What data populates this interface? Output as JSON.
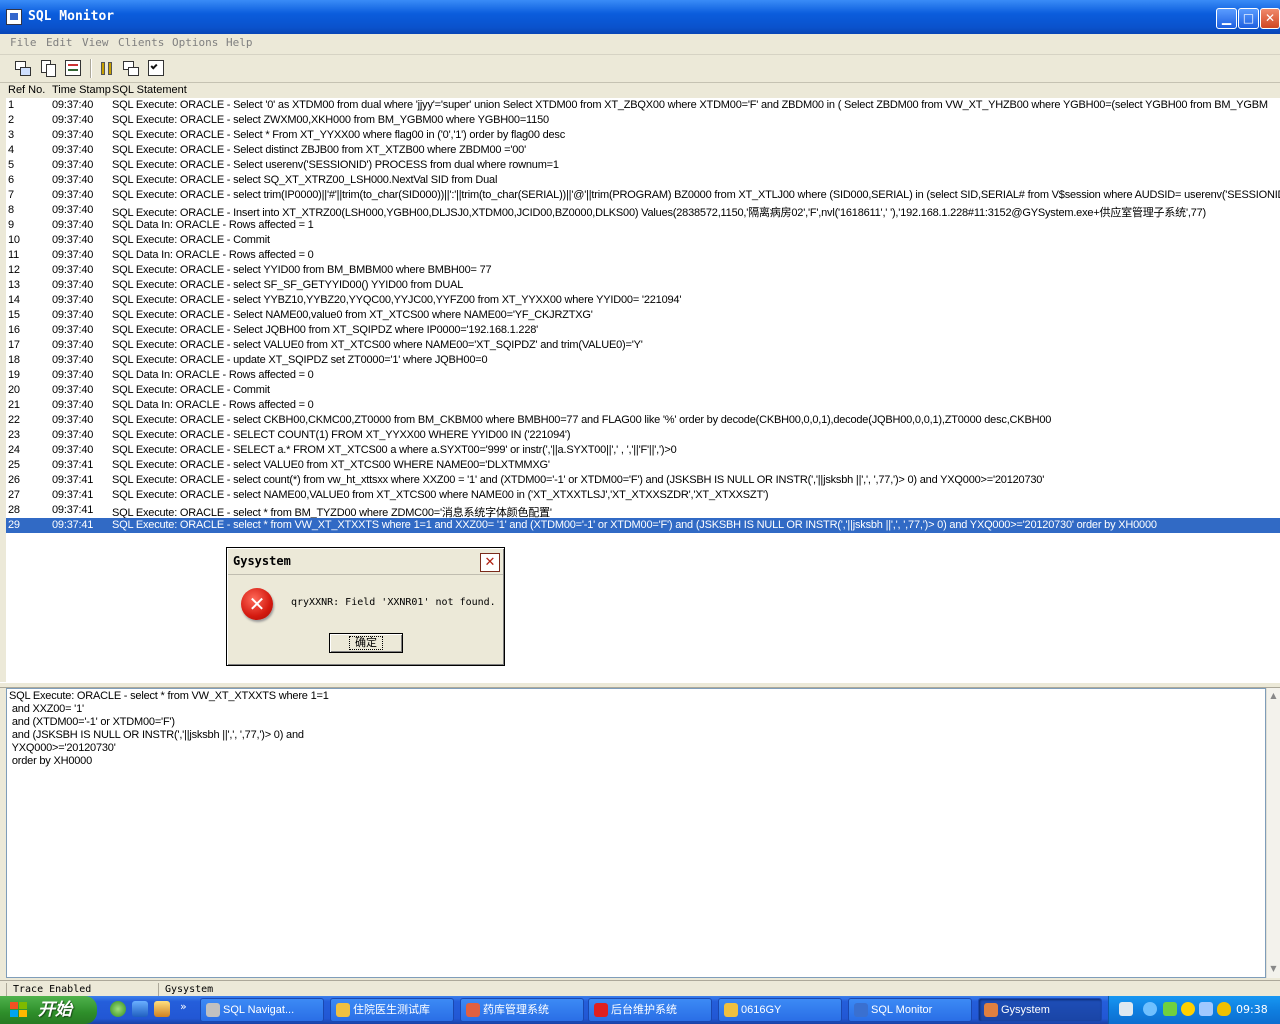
{
  "window": {
    "title": "SQL Monitor"
  },
  "menu": [
    "File",
    "Edit",
    "View",
    "Clients",
    "Options",
    "Help"
  ],
  "colors": {
    "selection": "#316ac5",
    "titlebar": "#0a52cc",
    "error": "#d41a10"
  },
  "grid": {
    "headers": [
      "Ref No.",
      "Time Stamp",
      "SQL Statement"
    ],
    "rows": [
      [
        "1",
        "09:37:40",
        "SQL Execute: ORACLE -  Select '0' as XTDM00 from dual where 'jjyy'='super' union  Select XTDM00 from XT_ZBQX00 where XTDM00='F' and ZBDM00 in ( Select ZBDM00 from VW_XT_YHZB00 where YGBH00=(select YGBH00  from BM_YGBM"
      ],
      [
        "2",
        "09:37:40",
        "SQL Execute: ORACLE - select ZWXM00,XKH000 from BM_YGBM00 where YGBH00=1150"
      ],
      [
        "3",
        "09:37:40",
        "SQL Execute: ORACLE -  Select * From XT_YYXX00 where flag00 in ('0','1') order by flag00 desc"
      ],
      [
        "4",
        "09:37:40",
        "SQL Execute: ORACLE -  Select distinct ZBJB00 from XT_XTZB00 where ZBDM00 ='00'"
      ],
      [
        "5",
        "09:37:40",
        "SQL Execute: ORACLE -  Select userenv('SESSIONID') PROCESS from dual where rownum=1"
      ],
      [
        "6",
        "09:37:40",
        "SQL Execute: ORACLE -  select SQ_XT_XTRZ00_LSH000.NextVal SID from Dual"
      ],
      [
        "7",
        "09:37:40",
        "SQL Execute: ORACLE -  select trim(IP0000)||'#'||trim(to_char(SID000))||':'||trim(to_char(SERIAL))||'@'||trim(PROGRAM) BZ0000 from XT_XTLJ00  where (SID000,SERIAL) in (select SID,SERIAL# from V$session where  AUDSID= userenv('SESSIONID"
      ],
      [
        "8",
        "09:37:40",
        "SQL Execute: ORACLE -  Insert into XT_XTRZ00(LSH000,YGBH00,DLJSJ0,XTDM00,JCID00,BZ0000,DLKS00)  Values(2838572,1150,'隔离病房02','F',nvl('1618611',' '),'192.168.1.228#11:3152@GYSystem.exe+供应室管理子系统',77)"
      ],
      [
        "9",
        "09:37:40",
        "SQL Data In: ORACLE - Rows affected = 1"
      ],
      [
        "10",
        "09:37:40",
        "SQL Execute: ORACLE - Commit"
      ],
      [
        "11",
        "09:37:40",
        "SQL Data In: ORACLE - Rows affected = 0"
      ],
      [
        "12",
        "09:37:40",
        "SQL Execute: ORACLE - select YYID00 from BM_BMBM00 where BMBH00= 77"
      ],
      [
        "13",
        "09:37:40",
        "SQL Execute: ORACLE - select SF_SF_GETYYID00() YYID00 from DUAL"
      ],
      [
        "14",
        "09:37:40",
        "SQL Execute: ORACLE - select YYBZ10,YYBZ20,YYQC00,YYJC00,YYFZ00 from XT_YYXX00 where YYID00= '221094'"
      ],
      [
        "15",
        "09:37:40",
        "SQL Execute: ORACLE -  Select NAME00,value0 from XT_XTCS00 where NAME00='YF_CKJRZTXG'"
      ],
      [
        "16",
        "09:37:40",
        "SQL Execute: ORACLE -  Select JQBH00 from XT_SQIPDZ where IP0000='192.168.1.228'"
      ],
      [
        "17",
        "09:37:40",
        "SQL Execute: ORACLE - select VALUE0 from XT_XTCS00 where NAME00='XT_SQIPDZ' and trim(VALUE0)='Y'"
      ],
      [
        "18",
        "09:37:40",
        "SQL Execute: ORACLE -  update XT_SQIPDZ set ZT0000='1' where JQBH00=0"
      ],
      [
        "19",
        "09:37:40",
        "SQL Data In: ORACLE - Rows affected = 0"
      ],
      [
        "20",
        "09:37:40",
        "SQL Execute: ORACLE - Commit"
      ],
      [
        "21",
        "09:37:40",
        "SQL Data In: ORACLE - Rows affected = 0"
      ],
      [
        "22",
        "09:37:40",
        "SQL Execute: ORACLE - select CKBH00,CKMC00,ZT0000 from BM_CKBM00 where BMBH00=77 and FLAG00 like '%' order by decode(CKBH00,0,0,1),decode(JQBH00,0,0,1),ZT0000 desc,CKBH00"
      ],
      [
        "23",
        "09:37:40",
        "SQL Execute: ORACLE - SELECT COUNT(1) FROM XT_YYXX00 WHERE YYID00 IN ('221094')"
      ],
      [
        "24",
        "09:37:40",
        "SQL Execute: ORACLE - SELECT a.* FROM XT_XTCS00 a where a.SYXT00='999' or instr(','||a.SYXT00||',' , ','||'F'||',')>0"
      ],
      [
        "25",
        "09:37:41",
        "SQL Execute: ORACLE - select VALUE0 from XT_XTCS00 WHERE NAME00='DLXTMMXG'"
      ],
      [
        "26",
        "09:37:41",
        "SQL Execute: ORACLE - select count(*) from vw_ht_xttsxx where XXZ00 = '1' and (XTDM00='-1' or XTDM00='F') and (JSKSBH IS NULL OR INSTR(','||jsksbh ||',', ',77,')> 0) and YXQ000>='20120730'"
      ],
      [
        "27",
        "09:37:41",
        "SQL Execute: ORACLE - select NAME00,VALUE0 from XT_XTCS00 where NAME00 in ('XT_XTXXTLSJ','XT_XTXXSZDR','XT_XTXXSZT')"
      ],
      [
        "28",
        "09:37:41",
        "SQL Execute: ORACLE - select * from BM_TYZD00 where ZDMC00='消息系统字体颜色配置'"
      ],
      [
        "29",
        "09:37:41",
        "SQL Execute: ORACLE - select * from VW_XT_XTXXTS where 1=1 and XXZ00= '1' and (XTDM00='-1' or XTDM00='F')  and (JSKSBH IS NULL OR INSTR(','||jsksbh ||',', ',77,')> 0) and  YXQ000>='20120730' order by XH0000"
      ]
    ]
  },
  "detail": {
    "lines": [
      "SQL Execute: ORACLE - select * from VW_XT_XTXXTS where 1=1",
      " and XXZ00= '1'",
      " and (XTDM00='-1' or XTDM00='F')",
      " and (JSKSBH IS NULL OR INSTR(','||jsksbh ||',', ',77,')> 0) and",
      " YXQ000>='20120730'",
      " order by XH0000"
    ]
  },
  "status": {
    "left": "Trace Enabled",
    "right": "Gysystem"
  },
  "dialog": {
    "title": "Gysystem",
    "message": "qryXXNR: Field 'XXNR01' not found.",
    "ok_label": "确定",
    "close_glyph": "✕",
    "icon": "error-icon",
    "icon_glyph": "✕"
  },
  "taskbar": {
    "start_label": "开始",
    "tasks": [
      {
        "label": "SQL Navigat...",
        "icon": "sql-navigator-icon"
      },
      {
        "label": "住院医生测试库",
        "icon": "folder-icon"
      },
      {
        "label": "药库管理系统",
        "icon": "app-icon"
      },
      {
        "label": "后台维护系统",
        "icon": "red-cross-icon"
      },
      {
        "label": "0616GY",
        "icon": "folder-icon"
      },
      {
        "label": "SQL Monitor",
        "icon": "sql-monitor-icon"
      },
      {
        "label": "Gysystem",
        "icon": "app-icon"
      }
    ],
    "clock": "09:38"
  }
}
